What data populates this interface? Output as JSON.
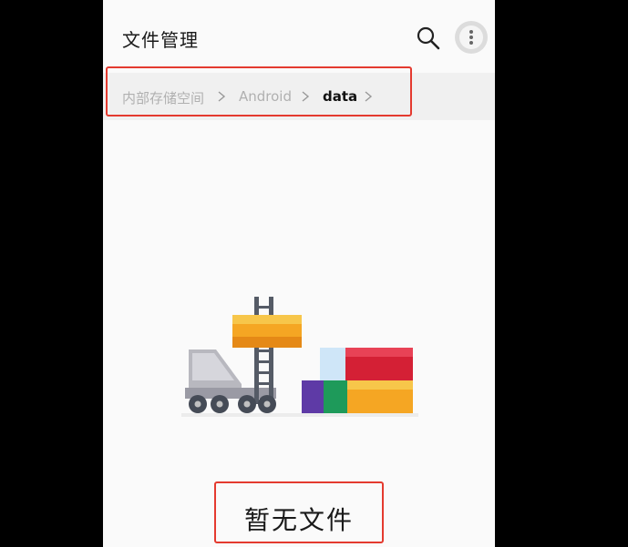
{
  "app": {
    "title": "文件管理"
  },
  "header": {
    "search_icon": "search-icon",
    "more_icon": "more-vertical-icon"
  },
  "breadcrumb": {
    "items": [
      {
        "label": "内部存储空间",
        "current": false
      },
      {
        "label": "Android",
        "current": false
      },
      {
        "label": "data",
        "current": true
      }
    ],
    "separator_icon": "chevron-right-icon"
  },
  "empty_state": {
    "message": "暂无文件",
    "illustration": "forklift-containers-illustration"
  },
  "colors": {
    "highlight": "#e43a2f",
    "background": "#fafafa",
    "breadcrumb_bg": "#f0f0f0",
    "orange": "#f5a623",
    "red": "#e0263c"
  }
}
